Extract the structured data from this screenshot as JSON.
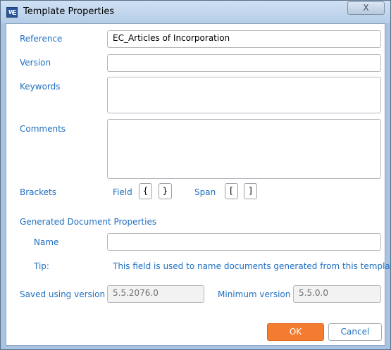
{
  "window": {
    "title": "Template Properties",
    "close_glyph": "X",
    "icon": "word-doc-icon",
    "icon_letter": "W"
  },
  "form": {
    "reference": {
      "label": "Reference",
      "value": "EC_Articles of Incorporation"
    },
    "version": {
      "label": "Version",
      "value": ""
    },
    "keywords": {
      "label": "Keywords",
      "value": ""
    },
    "comments": {
      "label": "Comments",
      "value": ""
    },
    "brackets": {
      "label": "Brackets",
      "field_label": "Field",
      "field_open": "{",
      "field_close": "}",
      "span_label": "Span",
      "span_open": "[",
      "span_close": "]"
    },
    "generated": {
      "heading": "Generated Document Properties",
      "name_label": "Name",
      "name_value": "",
      "tip_label": "Tip:",
      "tip_text": "This field is used to name documents generated from this template."
    },
    "saved_using_version": {
      "label": "Saved using version",
      "value": "5.5.2076.0"
    },
    "minimum_version": {
      "label": "Minimum version",
      "value": "5.5.0.0"
    }
  },
  "buttons": {
    "ok": "OK",
    "cancel": "Cancel"
  },
  "colors": {
    "label_blue": "#1f6fc0",
    "ok_orange": "#f47c30",
    "frame_blue": "#a9c4e2"
  }
}
